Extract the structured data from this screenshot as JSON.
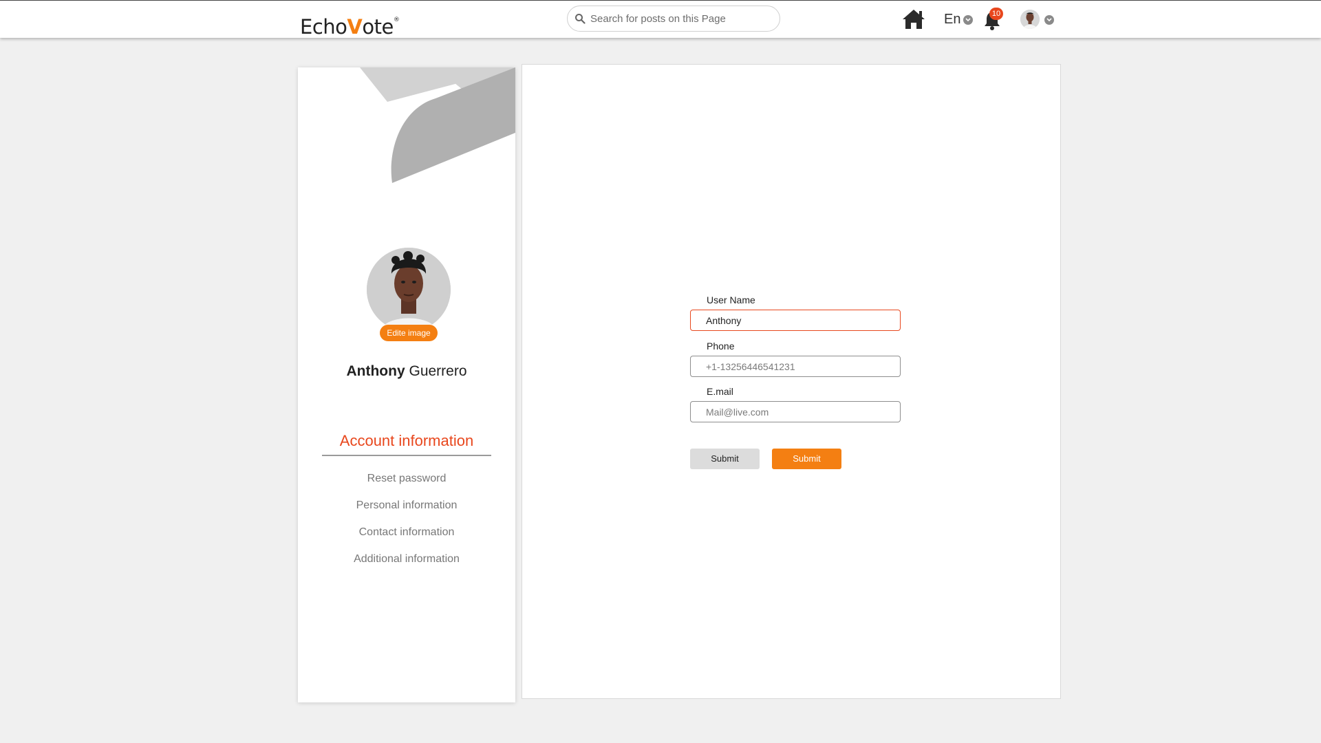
{
  "header": {
    "logo_prefix": "Echo",
    "logo_v": "V",
    "logo_suffix": "ote",
    "logo_mark": "®",
    "search_placeholder": "Search for posts on this Page",
    "language": "En",
    "notification_count": "10",
    "icons": [
      "search-icon",
      "home-icon",
      "chevron-down-icon",
      "bell-icon",
      "avatar"
    ]
  },
  "profile": {
    "edit_image_label": "Edite image",
    "first_name": "Anthony",
    "last_name": "Guerrero"
  },
  "sidebar": {
    "title": "Account information",
    "items": [
      {
        "label": "Reset password"
      },
      {
        "label": "Personal information"
      },
      {
        "label": "Contact information"
      },
      {
        "label": "Additional information"
      }
    ]
  },
  "form": {
    "username": {
      "label": "User Name",
      "value": "Anthony"
    },
    "phone": {
      "label": "Phone",
      "placeholder": "+1-13256446541231"
    },
    "email": {
      "label": "E.mail",
      "placeholder": "Mail@live.com"
    },
    "buttons": {
      "secondary": "Submit",
      "primary": "Submit"
    }
  },
  "colors": {
    "accent": "#f47f12",
    "active": "#e8471d",
    "background": "#f0f0f0"
  }
}
